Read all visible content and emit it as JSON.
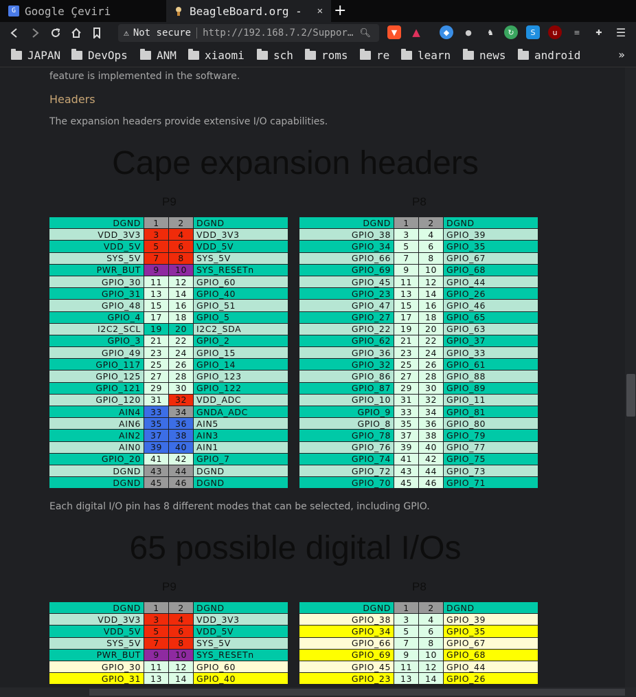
{
  "browser": {
    "tabs": [
      {
        "title": "Google Çeviri",
        "icon": "google-translate-icon",
        "active": false
      },
      {
        "title": "BeagleBoard.org -",
        "icon": "beagleboard-icon",
        "active": true
      }
    ],
    "toolbar": {
      "security_label": "Not secure",
      "url": "http://192.168.7.2/Suppor…"
    },
    "bookmarks": [
      "JAPAN",
      "DevOps",
      "ANM",
      "xiaomi",
      "sch",
      "roms",
      "re",
      "learn",
      "news",
      "android"
    ],
    "bookmarks_more": "»"
  },
  "page": {
    "intro_text": "feature is implemented in the software.",
    "headers_heading": "Headers",
    "headers_text": "The expansion headers provide extensive I/O capabilities.",
    "cape_title": "Cape expansion headers",
    "p9_label": "P9",
    "p8_label": "P8",
    "modes_text": "Each digital I/O pin has 8 different modes that can be selected, including GPIO.",
    "gpio_title": "65 possible digital I/Os",
    "p9_label_2": "P9",
    "p8_label_2": "P8"
  },
  "colors": {
    "teal": "#00c9a7",
    "mint": "#b6e6d3",
    "red": "#f02b0a",
    "purple": "#8e2aa0",
    "blue": "#3c6ee6",
    "gray": "#999999",
    "light_green": "#dcfde6",
    "yellow": "#ffff00",
    "cream": "#fffcd4"
  },
  "p9_table": [
    {
      "left": "DGND",
      "a": "1",
      "b": "2",
      "right": "DGND",
      "row": "teal",
      "ca": "gray",
      "cb": "gray"
    },
    {
      "left": "VDD_3V3",
      "a": "3",
      "b": "4",
      "right": "VDD_3V3",
      "row": "mint",
      "ca": "red",
      "cb": "red"
    },
    {
      "left": "VDD_5V",
      "a": "5",
      "b": "6",
      "right": "VDD_5V",
      "row": "teal",
      "ca": "red",
      "cb": "red"
    },
    {
      "left": "SYS_5V",
      "a": "7",
      "b": "8",
      "right": "SYS_5V",
      "row": "mint",
      "ca": "red",
      "cb": "red"
    },
    {
      "left": "PWR_BUT",
      "a": "9",
      "b": "10",
      "right": "SYS_RESETn",
      "row": "teal",
      "ca": "purple",
      "cb": "purple"
    },
    {
      "left": "GPIO_30",
      "a": "11",
      "b": "12",
      "right": "GPIO_60",
      "row": "mint",
      "ca": "light_green",
      "cb": "light_green"
    },
    {
      "left": "GPIO_31",
      "a": "13",
      "b": "14",
      "right": "GPIO_40",
      "row": "teal",
      "ca": "light_green",
      "cb": "light_green"
    },
    {
      "left": "GPIO_48",
      "a": "15",
      "b": "16",
      "right": "GPIO_51",
      "row": "mint",
      "ca": "light_green",
      "cb": "light_green"
    },
    {
      "left": "GPIO_4",
      "a": "17",
      "b": "18",
      "right": "GPIO_5",
      "row": "teal",
      "ca": "light_green",
      "cb": "light_green"
    },
    {
      "left": "I2C2_SCL",
      "a": "19",
      "b": "20",
      "right": "I2C2_SDA",
      "row": "mint",
      "ca": "teal",
      "cb": "teal"
    },
    {
      "left": "GPIO_3",
      "a": "21",
      "b": "22",
      "right": "GPIO_2",
      "row": "teal",
      "ca": "light_green",
      "cb": "light_green"
    },
    {
      "left": "GPIO_49",
      "a": "23",
      "b": "24",
      "right": "GPIO_15",
      "row": "mint",
      "ca": "light_green",
      "cb": "light_green"
    },
    {
      "left": "GPIO_117",
      "a": "25",
      "b": "26",
      "right": "GPIO_14",
      "row": "teal",
      "ca": "light_green",
      "cb": "light_green"
    },
    {
      "left": "GPIO_125",
      "a": "27",
      "b": "28",
      "right": "GPIO_123",
      "row": "mint",
      "ca": "light_green",
      "cb": "light_green"
    },
    {
      "left": "GPIO_121",
      "a": "29",
      "b": "30",
      "right": "GPIO_122",
      "row": "teal",
      "ca": "light_green",
      "cb": "light_green"
    },
    {
      "left": "GPIO_120",
      "a": "31",
      "b": "32",
      "right": "VDD_ADC",
      "row": "mint",
      "ca": "light_green",
      "cb": "red"
    },
    {
      "left": "AIN4",
      "a": "33",
      "b": "34",
      "right": "GNDA_ADC",
      "row": "teal",
      "ca": "blue",
      "cb": "gray"
    },
    {
      "left": "AIN6",
      "a": "35",
      "b": "36",
      "right": "AIN5",
      "row": "mint",
      "ca": "blue",
      "cb": "blue"
    },
    {
      "left": "AIN2",
      "a": "37",
      "b": "38",
      "right": "AIN3",
      "row": "teal",
      "ca": "blue",
      "cb": "blue"
    },
    {
      "left": "AIN0",
      "a": "39",
      "b": "40",
      "right": "AIN1",
      "row": "mint",
      "ca": "blue",
      "cb": "blue"
    },
    {
      "left": "GPIO_20",
      "a": "41",
      "b": "42",
      "right": "GPIO_7",
      "row": "teal",
      "ca": "light_green",
      "cb": "light_green"
    },
    {
      "left": "DGND",
      "a": "43",
      "b": "44",
      "right": "DGND",
      "row": "mint",
      "ca": "gray",
      "cb": "gray"
    },
    {
      "left": "DGND",
      "a": "45",
      "b": "46",
      "right": "DGND",
      "row": "teal",
      "ca": "gray",
      "cb": "gray"
    }
  ],
  "p8_table": [
    {
      "left": "DGND",
      "a": "1",
      "b": "2",
      "right": "DGND",
      "row": "teal",
      "ca": "gray",
      "cb": "gray"
    },
    {
      "left": "GPIO_38",
      "a": "3",
      "b": "4",
      "right": "GPIO_39",
      "row": "mint",
      "ca": "light_green",
      "cb": "light_green"
    },
    {
      "left": "GPIO_34",
      "a": "5",
      "b": "6",
      "right": "GPIO_35",
      "row": "teal",
      "ca": "light_green",
      "cb": "light_green"
    },
    {
      "left": "GPIO_66",
      "a": "7",
      "b": "8",
      "right": "GPIO_67",
      "row": "mint",
      "ca": "light_green",
      "cb": "light_green"
    },
    {
      "left": "GPIO_69",
      "a": "9",
      "b": "10",
      "right": "GPIO_68",
      "row": "teal",
      "ca": "light_green",
      "cb": "light_green"
    },
    {
      "left": "GPIO_45",
      "a": "11",
      "b": "12",
      "right": "GPIO_44",
      "row": "mint",
      "ca": "light_green",
      "cb": "light_green"
    },
    {
      "left": "GPIO_23",
      "a": "13",
      "b": "14",
      "right": "GPIO_26",
      "row": "teal",
      "ca": "light_green",
      "cb": "light_green"
    },
    {
      "left": "GPIO_47",
      "a": "15",
      "b": "16",
      "right": "GPIO_46",
      "row": "mint",
      "ca": "light_green",
      "cb": "light_green"
    },
    {
      "left": "GPIO_27",
      "a": "17",
      "b": "18",
      "right": "GPIO_65",
      "row": "teal",
      "ca": "light_green",
      "cb": "light_green"
    },
    {
      "left": "GPIO_22",
      "a": "19",
      "b": "20",
      "right": "GPIO_63",
      "row": "mint",
      "ca": "light_green",
      "cb": "light_green"
    },
    {
      "left": "GPIO_62",
      "a": "21",
      "b": "22",
      "right": "GPIO_37",
      "row": "teal",
      "ca": "light_green",
      "cb": "light_green"
    },
    {
      "left": "GPIO_36",
      "a": "23",
      "b": "24",
      "right": "GPIO_33",
      "row": "mint",
      "ca": "light_green",
      "cb": "light_green"
    },
    {
      "left": "GPIO_32",
      "a": "25",
      "b": "26",
      "right": "GPIO_61",
      "row": "teal",
      "ca": "light_green",
      "cb": "light_green"
    },
    {
      "left": "GPIO_86",
      "a": "27",
      "b": "28",
      "right": "GPIO_88",
      "row": "mint",
      "ca": "light_green",
      "cb": "light_green"
    },
    {
      "left": "GPIO_87",
      "a": "29",
      "b": "30",
      "right": "GPIO_89",
      "row": "teal",
      "ca": "light_green",
      "cb": "light_green"
    },
    {
      "left": "GPIO_10",
      "a": "31",
      "b": "32",
      "right": "GPIO_11",
      "row": "mint",
      "ca": "light_green",
      "cb": "light_green"
    },
    {
      "left": "GPIO_9",
      "a": "33",
      "b": "34",
      "right": "GPIO_81",
      "row": "teal",
      "ca": "light_green",
      "cb": "light_green"
    },
    {
      "left": "GPIO_8",
      "a": "35",
      "b": "36",
      "right": "GPIO_80",
      "row": "mint",
      "ca": "light_green",
      "cb": "light_green"
    },
    {
      "left": "GPIO_78",
      "a": "37",
      "b": "38",
      "right": "GPIO_79",
      "row": "teal",
      "ca": "light_green",
      "cb": "light_green"
    },
    {
      "left": "GPIO_76",
      "a": "39",
      "b": "40",
      "right": "GPIO_77",
      "row": "mint",
      "ca": "light_green",
      "cb": "light_green"
    },
    {
      "left": "GPIO_74",
      "a": "41",
      "b": "42",
      "right": "GPIO_75",
      "row": "teal",
      "ca": "light_green",
      "cb": "light_green"
    },
    {
      "left": "GPIO_72",
      "a": "43",
      "b": "44",
      "right": "GPIO_73",
      "row": "mint",
      "ca": "light_green",
      "cb": "light_green"
    },
    {
      "left": "GPIO_70",
      "a": "45",
      "b": "46",
      "right": "GPIO_71",
      "row": "teal",
      "ca": "light_green",
      "cb": "light_green"
    }
  ],
  "p9_table_2": [
    {
      "left": "DGND",
      "a": "1",
      "b": "2",
      "right": "DGND",
      "row": "teal",
      "ca": "gray",
      "cb": "gray"
    },
    {
      "left": "VDD_3V3",
      "a": "3",
      "b": "4",
      "right": "VDD_3V3",
      "row": "mint",
      "ca": "red",
      "cb": "red"
    },
    {
      "left": "VDD_5V",
      "a": "5",
      "b": "6",
      "right": "VDD_5V",
      "row": "teal",
      "ca": "red",
      "cb": "red"
    },
    {
      "left": "SYS_5V",
      "a": "7",
      "b": "8",
      "right": "SYS_5V",
      "row": "mint",
      "ca": "red",
      "cb": "red"
    },
    {
      "left": "PWR_BUT",
      "a": "9",
      "b": "10",
      "right": "SYS_RESETn",
      "row": "teal",
      "ca": "purple",
      "cb": "purple"
    },
    {
      "left": "GPIO_30",
      "a": "11",
      "b": "12",
      "right": "GPIO_60",
      "row": "cream",
      "ca": "light_green",
      "cb": "light_green"
    },
    {
      "left": "GPIO_31",
      "a": "13",
      "b": "14",
      "right": "GPIO_40",
      "row": "yellow",
      "ca": "light_green",
      "cb": "light_green"
    }
  ],
  "p8_table_2": [
    {
      "left": "DGND",
      "a": "1",
      "b": "2",
      "right": "DGND",
      "row": "teal",
      "ca": "gray",
      "cb": "gray"
    },
    {
      "left": "GPIO_38",
      "a": "3",
      "b": "4",
      "right": "GPIO_39",
      "row": "cream",
      "ca": "light_green",
      "cb": "light_green"
    },
    {
      "left": "GPIO_34",
      "a": "5",
      "b": "6",
      "right": "GPIO_35",
      "row": "yellow",
      "ca": "light_green",
      "cb": "light_green"
    },
    {
      "left": "GPIO_66",
      "a": "7",
      "b": "8",
      "right": "GPIO_67",
      "row": "cream",
      "ca": "light_green",
      "cb": "light_green"
    },
    {
      "left": "GPIO_69",
      "a": "9",
      "b": "10",
      "right": "GPIO_68",
      "row": "yellow",
      "ca": "light_green",
      "cb": "light_green"
    },
    {
      "left": "GPIO_45",
      "a": "11",
      "b": "12",
      "right": "GPIO_44",
      "row": "cream",
      "ca": "light_green",
      "cb": "light_green"
    },
    {
      "left": "GPIO_23",
      "a": "13",
      "b": "14",
      "right": "GPIO_26",
      "row": "yellow",
      "ca": "light_green",
      "cb": "light_green"
    }
  ]
}
